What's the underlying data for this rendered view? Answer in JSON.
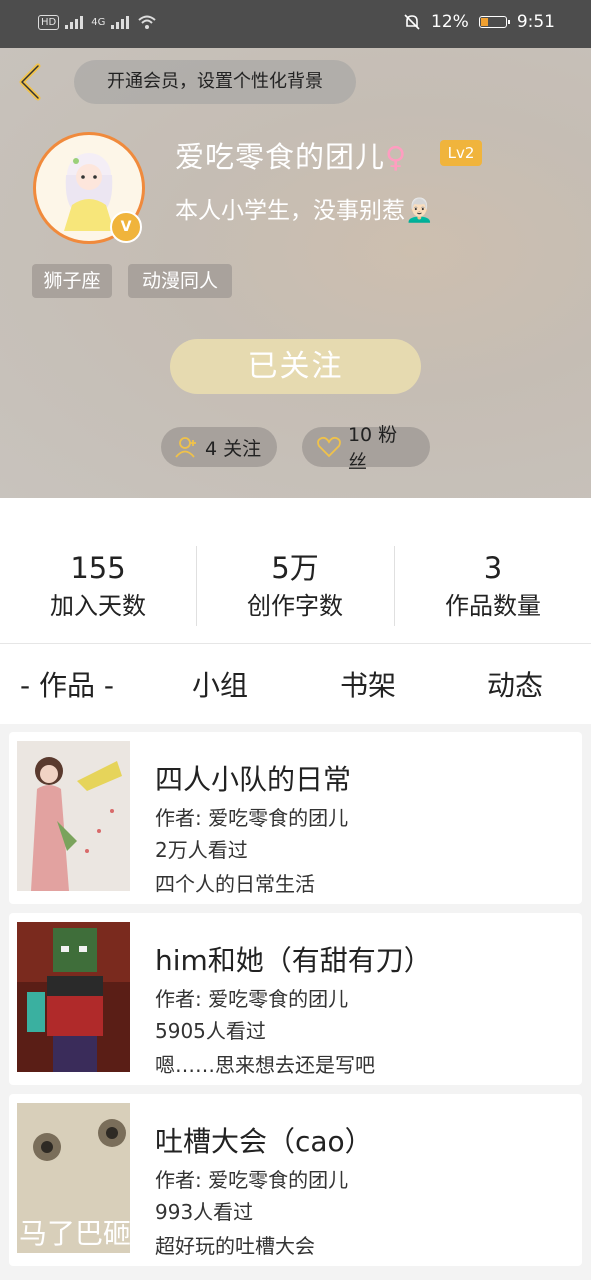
{
  "status_bar": {
    "left_indicators": [
      "HD",
      "4G"
    ],
    "battery_percent": "12%",
    "time": "9:51",
    "battery_level": 0.12
  },
  "header": {
    "vip_prompt": "开通会员，设置个性化背景",
    "username": "爱吃零食的团儿",
    "gender_symbol": "♀",
    "level": "Lv2",
    "verified_badge": "V",
    "bio": "本人小学生，没事别惹👨🏻‍🦳",
    "tags": [
      "狮子座",
      "动漫同人"
    ],
    "follow_button": "已关注",
    "following_count": "4 关注",
    "followers_count": "10 粉丝"
  },
  "stats": [
    {
      "value": "155",
      "label": "加入天数"
    },
    {
      "value": "5万",
      "label": "创作字数"
    },
    {
      "value": "3",
      "label": "作品数量"
    }
  ],
  "tabs": [
    "- 作品 -",
    "小组",
    "书架",
    "动态"
  ],
  "works": [
    {
      "title": "四人小队的日常",
      "author": "作者: 爱吃零食的团儿",
      "views": "2万人看过",
      "desc": "四个人的日常生活"
    },
    {
      "title": "him和她（有甜有刀）",
      "author": "作者: 爱吃零食的团儿",
      "views": "5905人看过",
      "desc": "嗯……思来想去还是写吧"
    },
    {
      "title": "吐槽大会（cao）",
      "author": "作者: 爱吃零食的团儿",
      "views": "993人看过",
      "desc": "超好玩的吐槽大会",
      "cover_text": "马了巴砸"
    }
  ],
  "colors": {
    "accent": "#f0b43c",
    "avatar_ring": "#f08a3c",
    "status_bar": "#4d4d4d"
  }
}
